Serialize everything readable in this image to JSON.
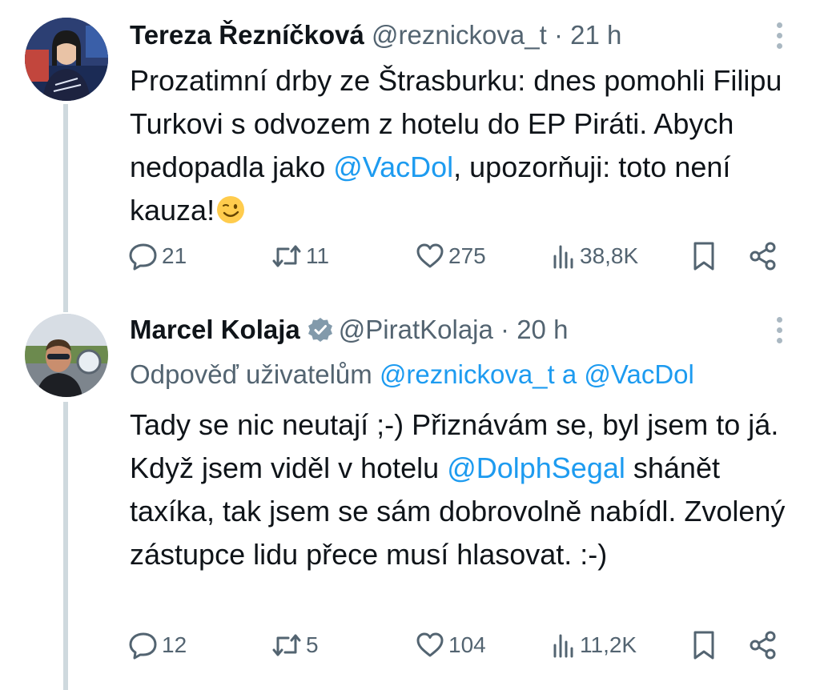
{
  "tweets": [
    {
      "name": "Tereza Řezníčková",
      "handle": "@reznickova_t",
      "sep": "·",
      "time": "21 h",
      "body_parts": [
        "Prozatimní drby ze Štrasburku: dnes pomohli Filipu Turkovi s odvozem z hotelu do EP Piráti. Abych nedopadla jako ",
        "@VacDol",
        ", upozorňuji: toto není kauza!"
      ],
      "emoji": "winking-face",
      "stats": {
        "replies": "21",
        "reposts": "11",
        "likes": "275",
        "views": "38,8K"
      }
    },
    {
      "name": "Marcel Kolaja",
      "verified": true,
      "handle": "@PiratKolaja",
      "sep": "·",
      "time": "20 h",
      "replying_prefix": "Odpověď uživatelům ",
      "replying_user1": "@reznickova_t",
      "replying_and": " a ",
      "replying_user2": "@VacDol",
      "body_parts": [
        "Tady se nic neutají ;-) Přiznávám se, byl jsem to já. Když jsem viděl v hotelu ",
        "@DolphSegal",
        " shánět taxíka, tak jsem se sám dobrovolně nabídl. Zvolený zástupce lidu přece musí hlasovat. :-)"
      ],
      "stats": {
        "replies": "12",
        "reposts": "5",
        "likes": "104",
        "views": "11,2K"
      }
    }
  ],
  "colors": {
    "text": "#0f1419",
    "secondary": "#536471",
    "link": "#1d9bf0",
    "thread_line": "#cfd9de"
  },
  "icons": [
    "reply-icon",
    "repost-icon",
    "like-icon",
    "views-icon",
    "bookmark-icon",
    "share-icon",
    "more-icon",
    "verified-icon"
  ]
}
